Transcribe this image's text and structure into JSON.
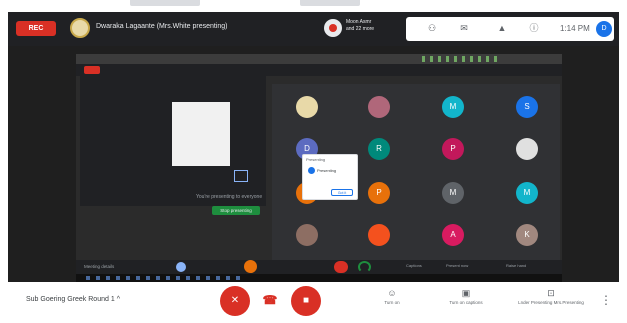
{
  "topbar": {
    "rec_label": "REC",
    "presenting_text": "Dwaraka Lagaante (Mrs.White presenting)",
    "recorder_name": "Moon Asmr",
    "recorder_sub": "and 22 more",
    "clock": "1:14 PM",
    "user_initial": "D"
  },
  "present": {
    "left_caption": "You're presenting to everyone",
    "stop_label": "Stop presenting",
    "popup_title": "Presenting",
    "popup_text": "Presenting",
    "popup_button": "Got it",
    "bottom_text": "Meeting details",
    "right_labels": [
      "Captions",
      "Present now",
      "Raise hand"
    ],
    "tiles": [
      {
        "initial": "",
        "color": "#e8d9a8",
        "label": ""
      },
      {
        "initial": "",
        "color": "#b0677a",
        "label": ""
      },
      {
        "initial": "M",
        "color": "#12b5cb",
        "label": ""
      },
      {
        "initial": "S",
        "color": "#1a73e8",
        "label": ""
      },
      {
        "initial": "D",
        "color": "#5c6bc0",
        "label": ""
      },
      {
        "initial": "R",
        "color": "#00897b",
        "label": ""
      },
      {
        "initial": "P",
        "color": "#c2185b",
        "label": ""
      },
      {
        "initial": "",
        "color": "#e0e0e0",
        "label": ""
      },
      {
        "initial": "",
        "color": "#e8710a",
        "label": ""
      },
      {
        "initial": "P",
        "color": "#e8710a",
        "label": ""
      },
      {
        "initial": "M",
        "color": "#5f6368",
        "label": ""
      },
      {
        "initial": "M",
        "color": "#12b5cb",
        "label": ""
      },
      {
        "initial": "",
        "color": "#8d6e63",
        "label": ""
      },
      {
        "initial": "",
        "color": "#f4511e",
        "label": ""
      },
      {
        "initial": "A",
        "color": "#d81b60",
        "label": ""
      },
      {
        "initial": "K",
        "color": "#a1887f",
        "label": ""
      }
    ]
  },
  "bottombar": {
    "meeting_title": "Sub Goering Greek Round 1",
    "chevron": "^",
    "mic_icon": "mic-off-icon",
    "cam_icon": "camera-off-icon",
    "actions": [
      {
        "icon": "person-icon",
        "label": "Turn on"
      },
      {
        "icon": "captions-icon",
        "label": "Turn on captions"
      },
      {
        "icon": "present-icon",
        "label": "Lnder Presenting Mrs.Presenting"
      }
    ]
  },
  "colors": {
    "danger": "#d93025",
    "accent": "#1a73e8",
    "dark_bg": "#202124"
  }
}
